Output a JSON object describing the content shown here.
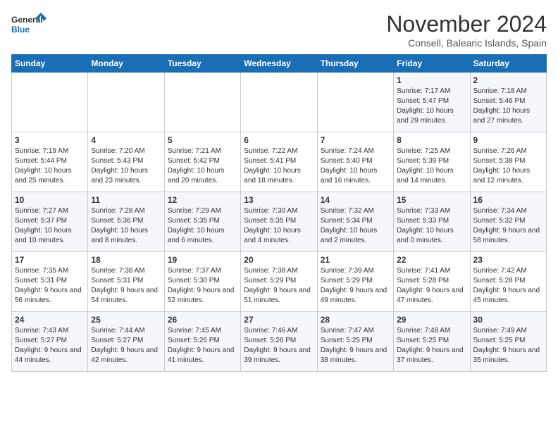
{
  "logo": {
    "line1": "General",
    "line2": "Blue"
  },
  "title": "November 2024",
  "location": "Consell, Balearic Islands, Spain",
  "weekdays": [
    "Sunday",
    "Monday",
    "Tuesday",
    "Wednesday",
    "Thursday",
    "Friday",
    "Saturday"
  ],
  "weeks": [
    [
      {
        "day": "",
        "info": ""
      },
      {
        "day": "",
        "info": ""
      },
      {
        "day": "",
        "info": ""
      },
      {
        "day": "",
        "info": ""
      },
      {
        "day": "",
        "info": ""
      },
      {
        "day": "1",
        "info": "Sunrise: 7:17 AM\nSunset: 5:47 PM\nDaylight: 10 hours and 29 minutes."
      },
      {
        "day": "2",
        "info": "Sunrise: 7:18 AM\nSunset: 5:46 PM\nDaylight: 10 hours and 27 minutes."
      }
    ],
    [
      {
        "day": "3",
        "info": "Sunrise: 7:19 AM\nSunset: 5:44 PM\nDaylight: 10 hours and 25 minutes."
      },
      {
        "day": "4",
        "info": "Sunrise: 7:20 AM\nSunset: 5:43 PM\nDaylight: 10 hours and 23 minutes."
      },
      {
        "day": "5",
        "info": "Sunrise: 7:21 AM\nSunset: 5:42 PM\nDaylight: 10 hours and 20 minutes."
      },
      {
        "day": "6",
        "info": "Sunrise: 7:22 AM\nSunset: 5:41 PM\nDaylight: 10 hours and 18 minutes."
      },
      {
        "day": "7",
        "info": "Sunrise: 7:24 AM\nSunset: 5:40 PM\nDaylight: 10 hours and 16 minutes."
      },
      {
        "day": "8",
        "info": "Sunrise: 7:25 AM\nSunset: 5:39 PM\nDaylight: 10 hours and 14 minutes."
      },
      {
        "day": "9",
        "info": "Sunrise: 7:26 AM\nSunset: 5:38 PM\nDaylight: 10 hours and 12 minutes."
      }
    ],
    [
      {
        "day": "10",
        "info": "Sunrise: 7:27 AM\nSunset: 5:37 PM\nDaylight: 10 hours and 10 minutes."
      },
      {
        "day": "11",
        "info": "Sunrise: 7:28 AM\nSunset: 5:36 PM\nDaylight: 10 hours and 8 minutes."
      },
      {
        "day": "12",
        "info": "Sunrise: 7:29 AM\nSunset: 5:35 PM\nDaylight: 10 hours and 6 minutes."
      },
      {
        "day": "13",
        "info": "Sunrise: 7:30 AM\nSunset: 5:35 PM\nDaylight: 10 hours and 4 minutes."
      },
      {
        "day": "14",
        "info": "Sunrise: 7:32 AM\nSunset: 5:34 PM\nDaylight: 10 hours and 2 minutes."
      },
      {
        "day": "15",
        "info": "Sunrise: 7:33 AM\nSunset: 5:33 PM\nDaylight: 10 hours and 0 minutes."
      },
      {
        "day": "16",
        "info": "Sunrise: 7:34 AM\nSunset: 5:32 PM\nDaylight: 9 hours and 58 minutes."
      }
    ],
    [
      {
        "day": "17",
        "info": "Sunrise: 7:35 AM\nSunset: 5:31 PM\nDaylight: 9 hours and 56 minutes."
      },
      {
        "day": "18",
        "info": "Sunrise: 7:36 AM\nSunset: 5:31 PM\nDaylight: 9 hours and 54 minutes."
      },
      {
        "day": "19",
        "info": "Sunrise: 7:37 AM\nSunset: 5:30 PM\nDaylight: 9 hours and 52 minutes."
      },
      {
        "day": "20",
        "info": "Sunrise: 7:38 AM\nSunset: 5:29 PM\nDaylight: 9 hours and 51 minutes."
      },
      {
        "day": "21",
        "info": "Sunrise: 7:39 AM\nSunset: 5:29 PM\nDaylight: 9 hours and 49 minutes."
      },
      {
        "day": "22",
        "info": "Sunrise: 7:41 AM\nSunset: 5:28 PM\nDaylight: 9 hours and 47 minutes."
      },
      {
        "day": "23",
        "info": "Sunrise: 7:42 AM\nSunset: 5:28 PM\nDaylight: 9 hours and 45 minutes."
      }
    ],
    [
      {
        "day": "24",
        "info": "Sunrise: 7:43 AM\nSunset: 5:27 PM\nDaylight: 9 hours and 44 minutes."
      },
      {
        "day": "25",
        "info": "Sunrise: 7:44 AM\nSunset: 5:27 PM\nDaylight: 9 hours and 42 minutes."
      },
      {
        "day": "26",
        "info": "Sunrise: 7:45 AM\nSunset: 5:26 PM\nDaylight: 9 hours and 41 minutes."
      },
      {
        "day": "27",
        "info": "Sunrise: 7:46 AM\nSunset: 5:26 PM\nDaylight: 9 hours and 39 minutes."
      },
      {
        "day": "28",
        "info": "Sunrise: 7:47 AM\nSunset: 5:25 PM\nDaylight: 9 hours and 38 minutes."
      },
      {
        "day": "29",
        "info": "Sunrise: 7:48 AM\nSunset: 5:25 PM\nDaylight: 9 hours and 37 minutes."
      },
      {
        "day": "30",
        "info": "Sunrise: 7:49 AM\nSunset: 5:25 PM\nDaylight: 9 hours and 35 minutes."
      }
    ]
  ]
}
